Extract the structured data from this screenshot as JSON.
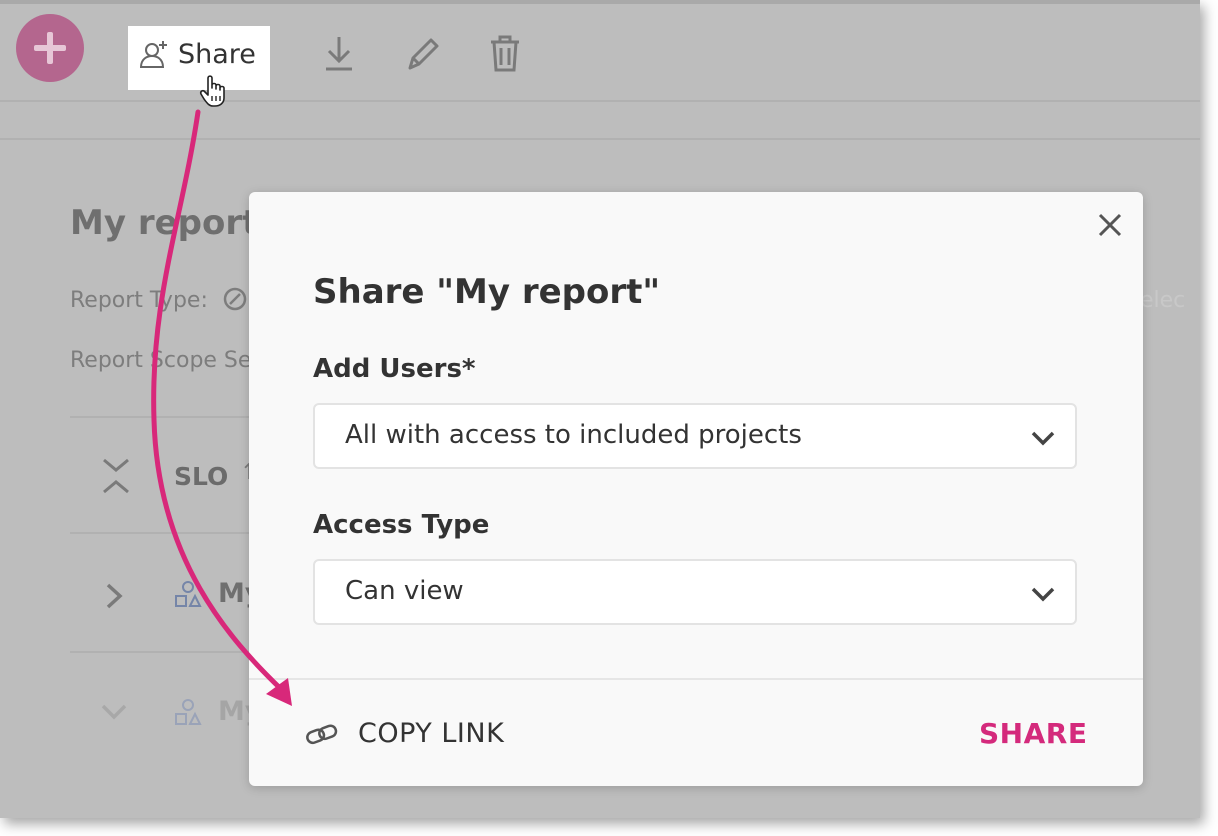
{
  "toolbar": {
    "add_button": "add",
    "share_label": "Share",
    "icons": [
      "share-user-icon",
      "download-icon",
      "pencil-icon",
      "trash-icon"
    ]
  },
  "background": {
    "report_title": "My report",
    "report_type_label": "Report Type:",
    "report_scope_label": "Report Scope Se",
    "right_fragment": "elec",
    "rows": [
      {
        "label": "SLO",
        "suffix": "↑"
      },
      {
        "label": "My"
      },
      {
        "label": "My"
      }
    ]
  },
  "modal": {
    "title": "Share \"My report\"",
    "add_users_label": "Add Users*",
    "add_users_value": "All with access to included projects",
    "access_type_label": "Access Type",
    "access_type_value": "Can view",
    "copy_link_label": "COPY LINK",
    "share_button_label": "SHARE"
  },
  "colors": {
    "accent": "#d42a7c",
    "overlay": "#bdbdbd",
    "modal_bg": "#f9f9f9"
  }
}
